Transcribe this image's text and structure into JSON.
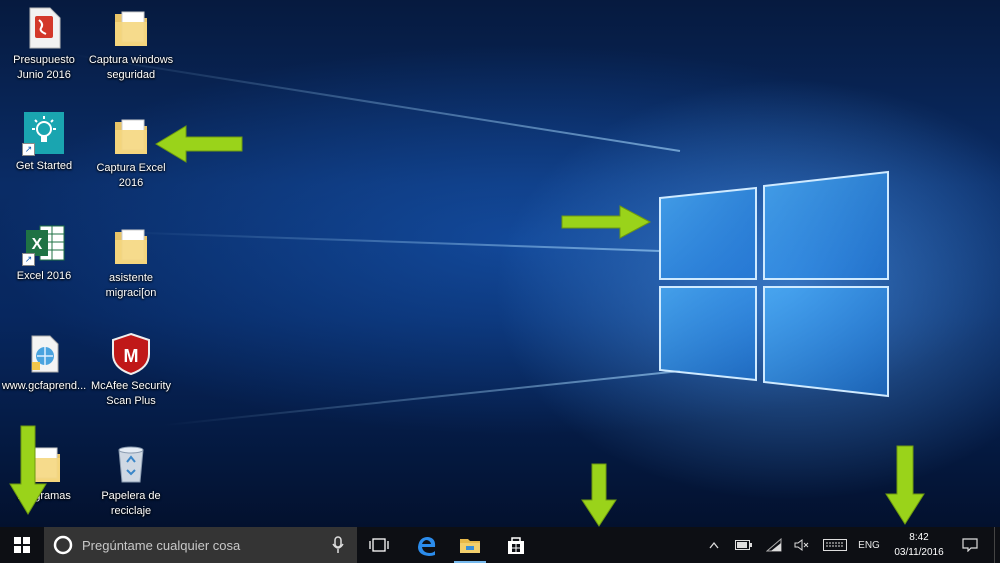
{
  "desktop_icons": [
    {
      "name": "icon-presupuesto",
      "label": "Presupuesto\nJunio 2016",
      "icon": "pdf-document-icon"
    },
    {
      "name": "icon-captura-windows",
      "label": "Captura windows\nseguridad",
      "icon": "folder-icon"
    },
    {
      "name": "icon-get-started",
      "label": "Get Started",
      "icon": "lightbulb-icon"
    },
    {
      "name": "icon-captura-excel",
      "label": "Captura Excel\n2016",
      "icon": "folder-icon"
    },
    {
      "name": "icon-excel-2016",
      "label": "Excel 2016",
      "icon": "excel-icon"
    },
    {
      "name": "icon-asistente",
      "label": "asistente\nmigraci[on",
      "icon": "folder-icon"
    },
    {
      "name": "icon-gcfaprende",
      "label": "www.gcfaprend...",
      "icon": "web-file-icon"
    },
    {
      "name": "icon-mcafee",
      "label": "McAfee Security\nScan Plus",
      "icon": "mcafee-shield-icon"
    },
    {
      "name": "icon-programas",
      "label": "Programas",
      "icon": "folder-icon"
    },
    {
      "name": "icon-papelera",
      "label": "Papelera de\nreciclaje",
      "icon": "recycle-bin-icon"
    }
  ],
  "taskbar": {
    "search_placeholder": "Pregúntame cualquier cosa",
    "pinned": [
      "task-view-icon",
      "edge-icon",
      "file-explorer-icon",
      "store-icon"
    ],
    "tray": {
      "language": "ENG",
      "time": "8:42",
      "date": "03/11/2016"
    }
  },
  "colors": {
    "arrow": "#9ad31a",
    "taskbar": "#0d0f14",
    "search_box": "#343434",
    "wallpaper": "#0a2c66"
  }
}
